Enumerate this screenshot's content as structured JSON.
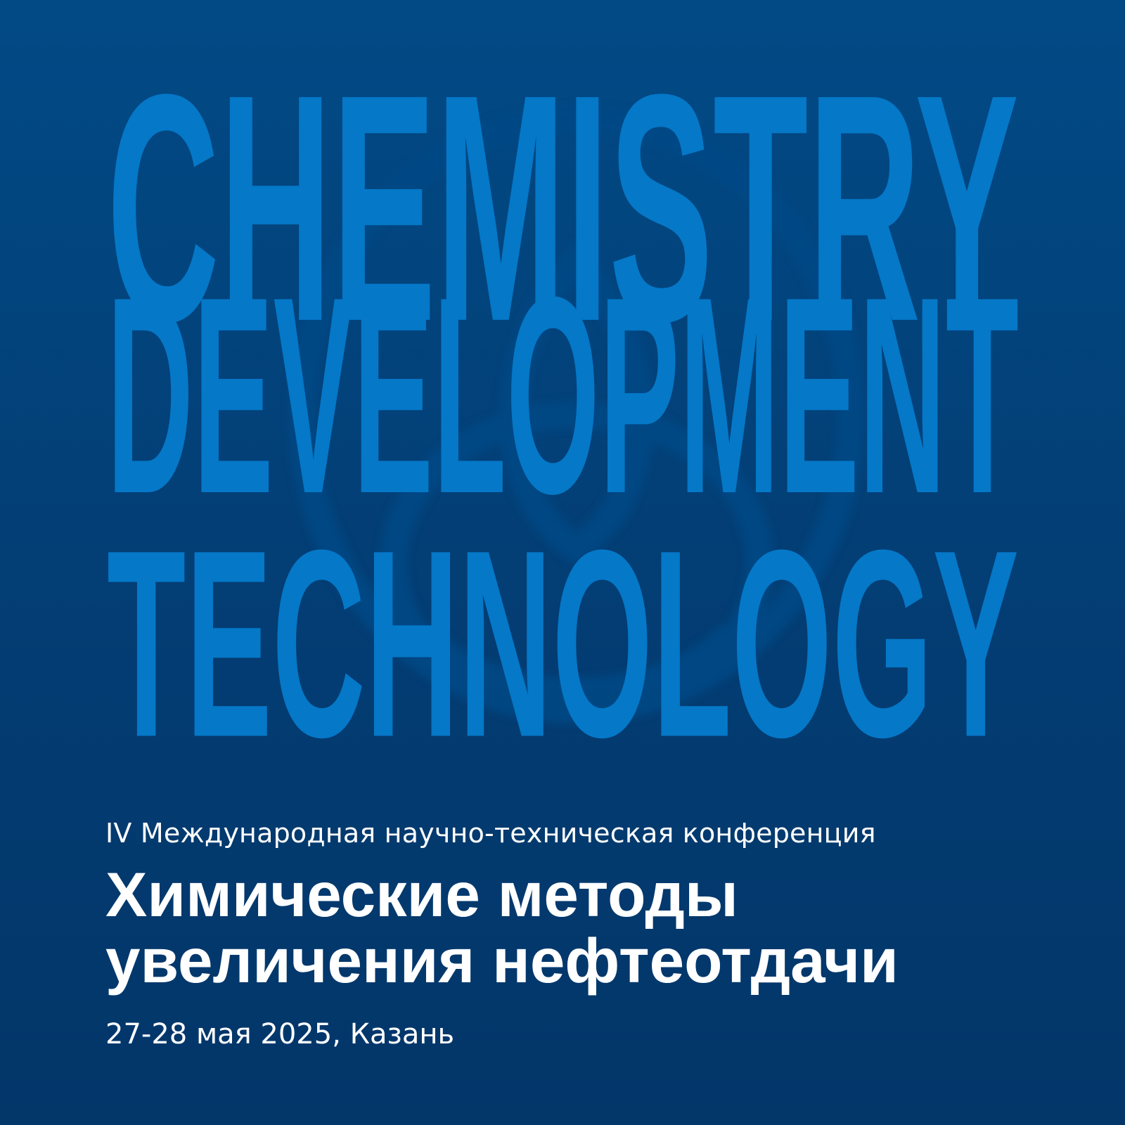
{
  "poster": {
    "headline_words": [
      "CHEMISTRY",
      "DEVELOPMENT",
      "TECHNOLOGY"
    ],
    "conference_subtitle": "IV Международная научно-техническая конференция",
    "title_line_1": "Химические методы",
    "title_line_2": "увеличения нефтеотдачи",
    "date_location": "27-28 мая 2025, Казань"
  },
  "colors": {
    "background_top": "#024a86",
    "background_bottom": "#033669",
    "headline": "#0578c8",
    "emblem": "#034e8c",
    "text": "#ffffff"
  },
  "icons": {
    "emblem": "flask-molecule-logo-watermark"
  }
}
